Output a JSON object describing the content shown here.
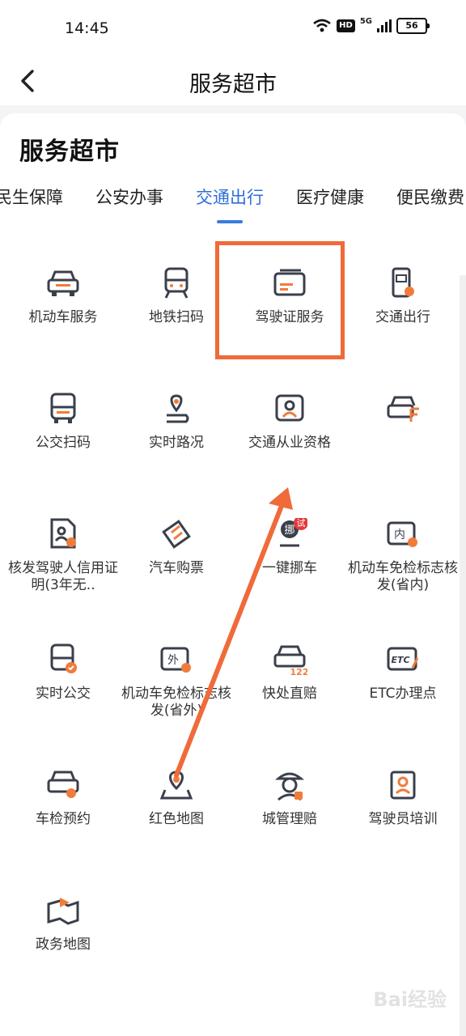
{
  "status_bar": {
    "time": "14:45",
    "network": "5G",
    "hd": "HD",
    "battery": "56"
  },
  "nav": {
    "title": "服务超市"
  },
  "section_title": "服务超市",
  "tabs": [
    {
      "label": "民生保障",
      "active": false
    },
    {
      "label": "公安办事",
      "active": false
    },
    {
      "label": "交通出行",
      "active": true
    },
    {
      "label": "医疗健康",
      "active": false
    },
    {
      "label": "便民缴费",
      "active": false
    }
  ],
  "items": [
    {
      "label": "机动车服务",
      "icon": "car-front-icon"
    },
    {
      "label": "地铁扫码",
      "icon": "subway-train-icon"
    },
    {
      "label": "驾驶证服务",
      "icon": "driver-license-card-icon"
    },
    {
      "label": "交通出行",
      "icon": "traffic-document-icon"
    },
    {
      "label": "公交扫码",
      "icon": "bus-front-icon"
    },
    {
      "label": "实时路况",
      "icon": "location-route-icon"
    },
    {
      "label": "交通从业资格",
      "icon": "id-badge-icon"
    },
    {
      "label": "",
      "icon": "car-tag-icon"
    },
    {
      "label": "核发驾驶人信用证明(3年无..",
      "icon": "credit-certificate-icon"
    },
    {
      "label": "汽车购票",
      "icon": "ticket-icon"
    },
    {
      "label": "一键挪车",
      "icon": "move-car-icon",
      "badge": "试",
      "badge_text": "挪"
    },
    {
      "label": "机动车免检标志核发(省内)",
      "icon": "inspection-inside-icon",
      "icon_text": "内"
    },
    {
      "label": "实时公交",
      "icon": "bus-check-icon"
    },
    {
      "label": "机动车免检标志核发(省外)",
      "icon": "inspection-outside-icon",
      "icon_text": "外"
    },
    {
      "label": "快处直赔",
      "icon": "car-122-icon",
      "icon_text": "122"
    },
    {
      "label": "ETC办理点",
      "icon": "etc-icon",
      "icon_text": "ETC"
    },
    {
      "label": "车检预约",
      "icon": "car-inspection-icon"
    },
    {
      "label": "红色地图",
      "icon": "red-map-icon"
    },
    {
      "label": "城管理赔",
      "icon": "officer-icon"
    },
    {
      "label": "驾驶员培训",
      "icon": "driver-training-icon"
    },
    {
      "label": "政务地图",
      "icon": "gov-map-icon"
    }
  ],
  "watermark": "Bai经验",
  "colors": {
    "accent": "#2f6fd8",
    "icon_dark": "#3a3f4b",
    "icon_orange": "#f07c3c",
    "highlight": "#f06a3a"
  }
}
